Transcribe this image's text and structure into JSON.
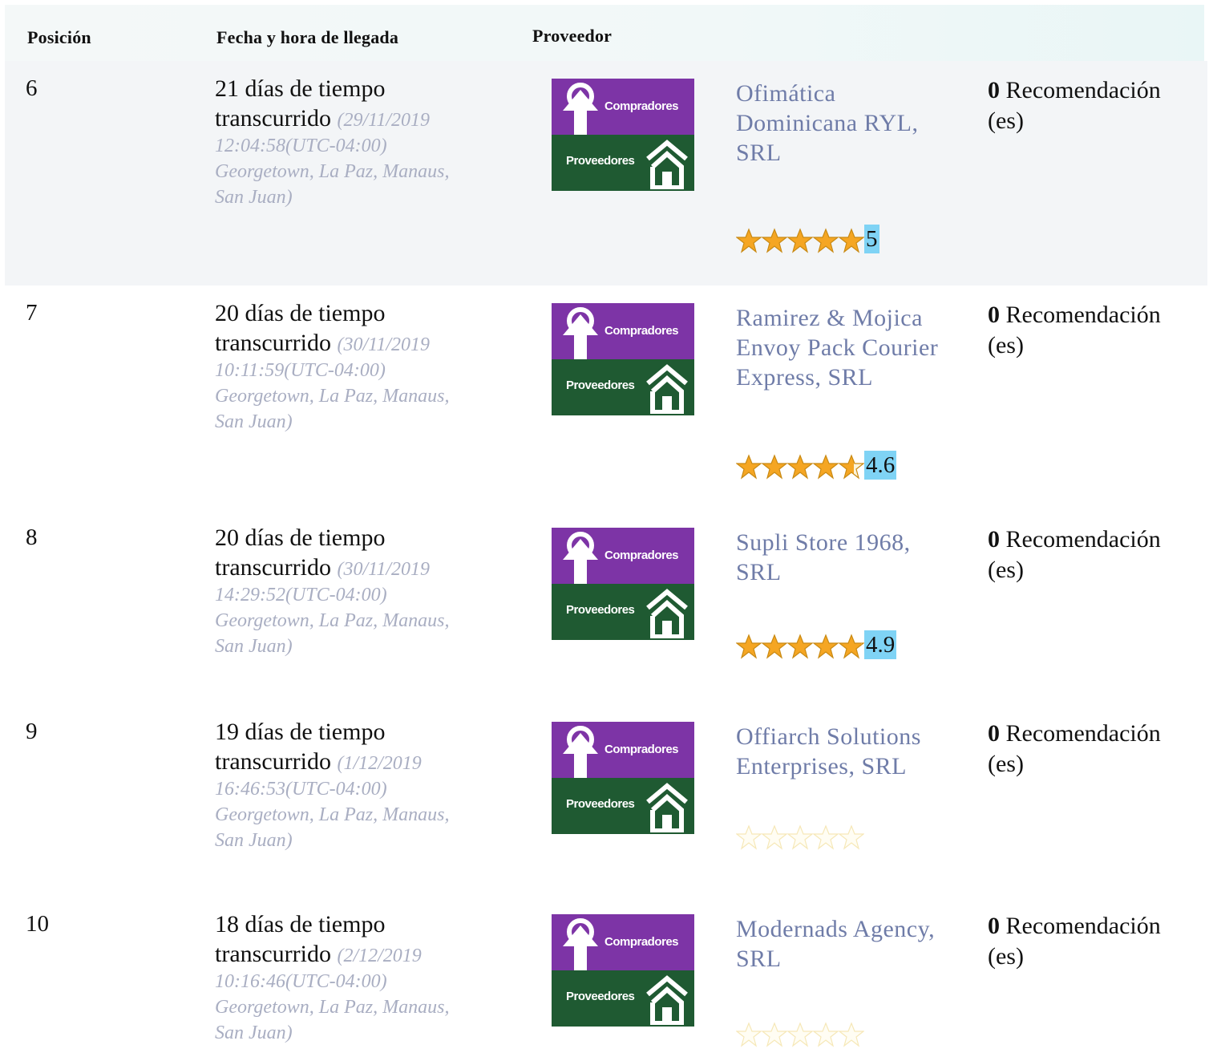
{
  "header": {
    "position": "Posición",
    "arrival": "Fecha y hora de llegada",
    "provider": "Proveedor"
  },
  "colors": {
    "logo_top": "#7d34a6",
    "logo_bottom": "#1f5a32",
    "provider_text": "#6f7ca8",
    "timestamp_text": "#a9aec2",
    "score_highlight": "#7fd3f5",
    "star_fill": "#f5a623"
  },
  "logo": {
    "top_label": "Compradores",
    "bottom_label": "Proveedores"
  },
  "rows": [
    {
      "position": "6",
      "elapsed_line1": "21 días de tiempo",
      "elapsed_line2": "transcurrido",
      "date": "(29/11/2019",
      "time": "12:04:58(UTC-04:00)",
      "tz1": "Georgetown, La Paz, Manaus,",
      "tz2": "San Juan)",
      "provider_lines": [
        "Ofimática",
        "Dominicana RYL,",
        "SRL"
      ],
      "rec_count": "0",
      "rec_label": "Recomendación",
      "rec_suffix": "(es)",
      "rating": 5,
      "rating_text": "5"
    },
    {
      "position": "7",
      "elapsed_line1": "20 días de tiempo",
      "elapsed_line2": "transcurrido",
      "date": "(30/11/2019",
      "time": "10:11:59(UTC-04:00)",
      "tz1": "Georgetown, La Paz, Manaus,",
      "tz2": "San Juan)",
      "provider_lines": [
        "Ramirez & Mojica",
        "Envoy Pack Courier",
        "Express, SRL"
      ],
      "rec_count": "0",
      "rec_label": "Recomendación",
      "rec_suffix": "(es)",
      "rating": 4.6,
      "rating_text": "4.6"
    },
    {
      "position": "8",
      "elapsed_line1": "20 días de tiempo",
      "elapsed_line2": "transcurrido",
      "date": "(30/11/2019",
      "time": "14:29:52(UTC-04:00)",
      "tz1": "Georgetown, La Paz, Manaus,",
      "tz2": "San Juan)",
      "provider_lines": [
        "Supli Store 1968,",
        "SRL"
      ],
      "rec_count": "0",
      "rec_label": "Recomendación",
      "rec_suffix": "(es)",
      "rating": 4.9,
      "rating_text": "4.9"
    },
    {
      "position": "9",
      "elapsed_line1": "19 días de tiempo",
      "elapsed_line2": "transcurrido",
      "date": "(1/12/2019",
      "time": "16:46:53(UTC-04:00)",
      "tz1": "Georgetown, La Paz, Manaus,",
      "tz2": "San Juan)",
      "provider_lines": [
        "Offiarch Solutions",
        "Enterprises, SRL"
      ],
      "rec_count": "0",
      "rec_label": "Recomendación",
      "rec_suffix": "(es)",
      "rating": 0,
      "rating_text": ""
    },
    {
      "position": "10",
      "elapsed_line1": "18 días de tiempo",
      "elapsed_line2": "transcurrido",
      "date": "(2/12/2019",
      "time": "10:16:46(UTC-04:00)",
      "tz1": "Georgetown, La Paz, Manaus,",
      "tz2": "San Juan)",
      "provider_lines": [
        "Modernads Agency,",
        "SRL"
      ],
      "rec_count": "0",
      "rec_label": "Recomendación",
      "rec_suffix": "(es)",
      "rating": 0,
      "rating_text": ""
    }
  ]
}
